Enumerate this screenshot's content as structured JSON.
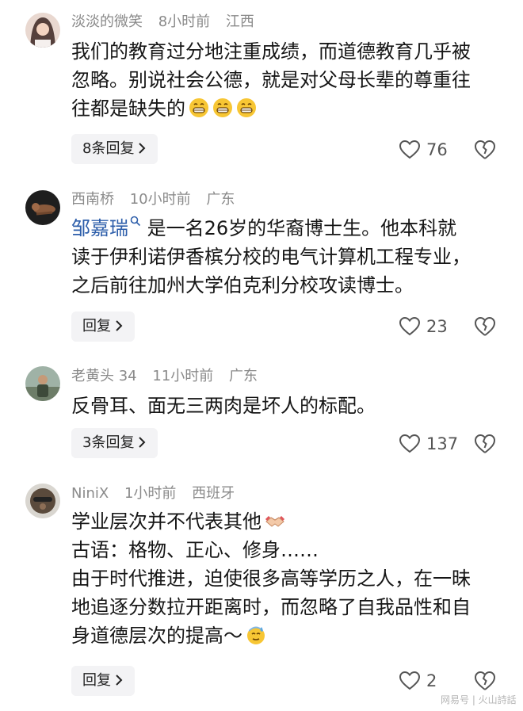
{
  "comments": [
    {
      "username": "淡淡的微笑",
      "time": "8小时前",
      "location": "江西",
      "lines": [
        "我们的教育过分地注重成绩，而道德教育几乎被",
        "忽略。别说社会公德，就是对父母长辈的尊重往",
        "往都是缺失的"
      ],
      "emojis": [
        "grinning-emoji",
        "grinning-emoji",
        "grinning-emoji"
      ],
      "reply_label": "8条回复",
      "likes": "76"
    },
    {
      "username": "西南桥",
      "time": "10小时前",
      "location": "广东",
      "mention": "邹嘉瑞",
      "lines": [
        "是一名26岁的华裔博士生。他本科就",
        "读于伊利诺伊香槟分校的电气计算机工程专业，",
        "之后前往加州大学伯克利分校攻读博士。"
      ],
      "reply_label": "回复",
      "likes": "23"
    },
    {
      "username": "老黄头 34",
      "time": "11小时前",
      "location": "广东",
      "lines": [
        "反骨耳、面无三两肉是坏人的标配。"
      ],
      "reply_label": "3条回复",
      "likes": "137"
    },
    {
      "username": "NiniX",
      "time": "1小时前",
      "location": "西班牙",
      "lines": [
        "学业层次并不代表其他",
        "古语：格物、正心、修身……",
        "由于时代推进，迫使很多高等学历之人，在一昧",
        "地追逐分数拉开距离时，而忽略了自我品性和自",
        "身道德层次的提高～"
      ],
      "emojis": [
        "handshake-emoji",
        "sweat-smile-emoji"
      ],
      "reply_label": "回复",
      "likes": "2"
    }
  ],
  "watermark": "网易号 | 火山詩話",
  "colors": {
    "mention": "#2d5eaa",
    "meta": "#8a8a8a",
    "reply_bg": "#f3f3f5"
  }
}
